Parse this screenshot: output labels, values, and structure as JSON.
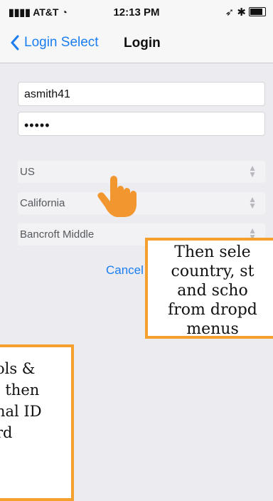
{
  "status_bar": {
    "carrier": "AT&T",
    "time": "12:13 PM",
    "right_icons": "location-arrow bluetooth battery"
  },
  "nav": {
    "back_label": "Login Select",
    "title": "Login"
  },
  "form": {
    "username_value": "asmith41",
    "password_value": "•••••"
  },
  "selects": [
    {
      "label": "US"
    },
    {
      "label": "California"
    },
    {
      "label": "Bancroft Middle"
    }
  ],
  "cancel_label": "Cancel",
  "callouts": {
    "right_lines": [
      "Then sele",
      "country, st",
      "and scho",
      "from dropd",
      "menus"
    ],
    "left_lines": [
      "ols &",
      ", then",
      "nal ID",
      "rd"
    ]
  },
  "colors": {
    "accent": "#1a7ef0",
    "callout_border": "#f3a02e",
    "hand": "#f2972f"
  }
}
